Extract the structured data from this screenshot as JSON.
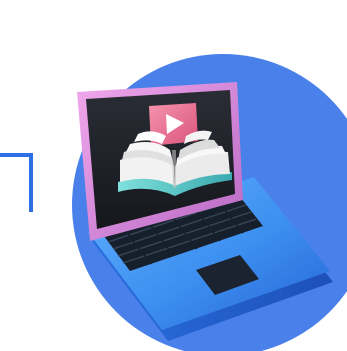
{
  "illustration": {
    "subject": "laptop-video-book",
    "colors": {
      "background": "#ffffff",
      "circle": "#4a80ea",
      "accent_line": "#2f6fe6",
      "screen_bezel": "#d98ad8",
      "screen": "#1d2026",
      "laptop_body": "#3d8ff0",
      "keyboard": "#16202c",
      "touchpad": "#1b2330",
      "play_button": "#ef7a9a",
      "play_triangle": "#ffffff",
      "book_pages": "#eeeeee",
      "book_base": "#58c6c3"
    },
    "icons": [
      "laptop-icon",
      "play-button-icon",
      "open-book-icon"
    ]
  }
}
